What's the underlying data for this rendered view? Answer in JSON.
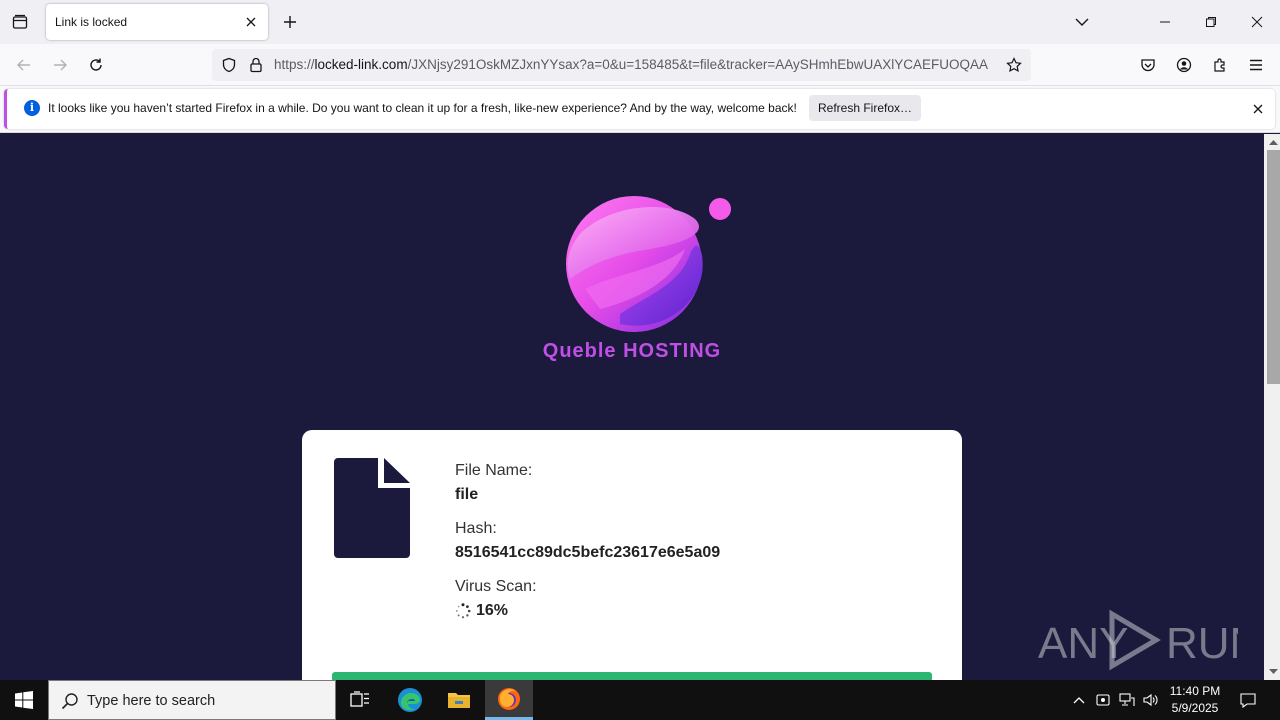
{
  "browser": {
    "tab_title": "Link is locked",
    "url_prefix": "https://",
    "url_host": "locked-link.com",
    "url_path": "/JXNjsy291OskMZJxnYYsax?a=0&u=158485&t=file&tracker=AAySHmhEbwUAXlYCAEFUOQAA"
  },
  "notification": {
    "message": "It looks like you haven’t started Firefox in a while. Do you want to clean it up for a fresh, like-new experience? And by the way, welcome back!",
    "button_label": "Refresh Firefox…"
  },
  "page": {
    "brand": "Queble HOSTING",
    "file": {
      "name_label": "File Name:",
      "name_value": "file",
      "hash_label": "Hash:",
      "hash_value": "8516541cc89dc5befc23617e6e5a09",
      "scan_label": "Virus Scan:",
      "scan_value": "16%",
      "scan_progress": 0.16
    },
    "watermark": "ANY RUN"
  },
  "taskbar": {
    "search_placeholder": "Type here to search",
    "time": "11:40 PM",
    "date": "5/9/2025"
  },
  "colors": {
    "page_bg": "#1b1a3d",
    "brand": "#c04fe5",
    "progress": "#2bb673"
  }
}
